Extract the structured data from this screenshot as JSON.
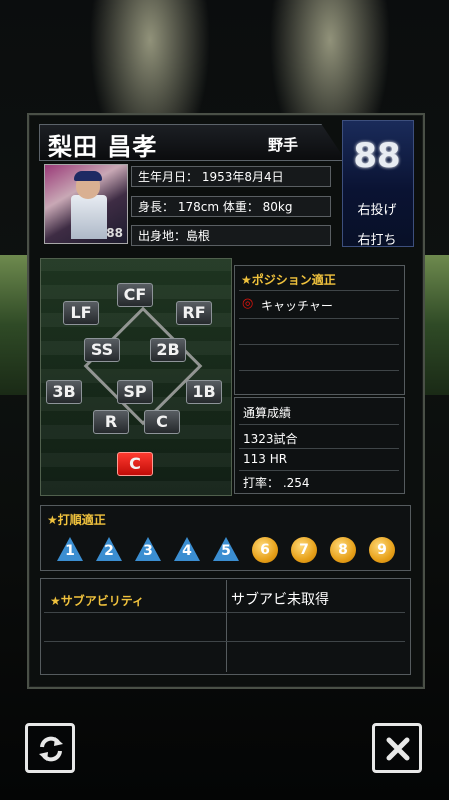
{
  "player": {
    "name": "梨田 昌孝",
    "type": "野手",
    "number": "88",
    "throws": "右投げ",
    "bats": "右打ち",
    "birthdate": "生年月日： 1953年8月4日",
    "body": "身長： 178cm 体重： 80kg",
    "birthplace": "出身地：島根",
    "photo_number": "88"
  },
  "field_positions": [
    {
      "label": "CF",
      "active": false
    },
    {
      "label": "LF",
      "active": false
    },
    {
      "label": "RF",
      "active": false
    },
    {
      "label": "SS",
      "active": false
    },
    {
      "label": "2B",
      "active": false
    },
    {
      "label": "3B",
      "active": false
    },
    {
      "label": "SP",
      "active": false
    },
    {
      "label": "1B",
      "active": false
    },
    {
      "label": "R",
      "active": false
    },
    {
      "label": "C",
      "active": false
    },
    {
      "label": "C",
      "active": true
    }
  ],
  "position_aptitude": {
    "title": "★ポジション適正",
    "marker": "◎",
    "position": "キャッチャー"
  },
  "career": {
    "title": "通算成績",
    "games": "1323試合",
    "hr": "113 HR",
    "avg": "打率： .254"
  },
  "batting_order": {
    "title": "★打順適正",
    "slots": [
      {
        "n": "1",
        "shape": "triangle"
      },
      {
        "n": "2",
        "shape": "triangle"
      },
      {
        "n": "3",
        "shape": "triangle"
      },
      {
        "n": "4",
        "shape": "triangle"
      },
      {
        "n": "5",
        "shape": "triangle"
      },
      {
        "n": "6",
        "shape": "circle"
      },
      {
        "n": "7",
        "shape": "circle"
      },
      {
        "n": "8",
        "shape": "circle"
      },
      {
        "n": "9",
        "shape": "circle"
      }
    ]
  },
  "sub_ability": {
    "title": "★サブアビリティ",
    "value": "サブアビ未取得"
  },
  "buttons": {
    "refresh_icon": "refresh-icon",
    "close_icon": "close-icon"
  },
  "colors": {
    "accent_gold": "#f0c23d",
    "active_red": "#e0140d",
    "triangle_blue": "#3b8ed1",
    "circle_orange": "#e7a11a"
  }
}
